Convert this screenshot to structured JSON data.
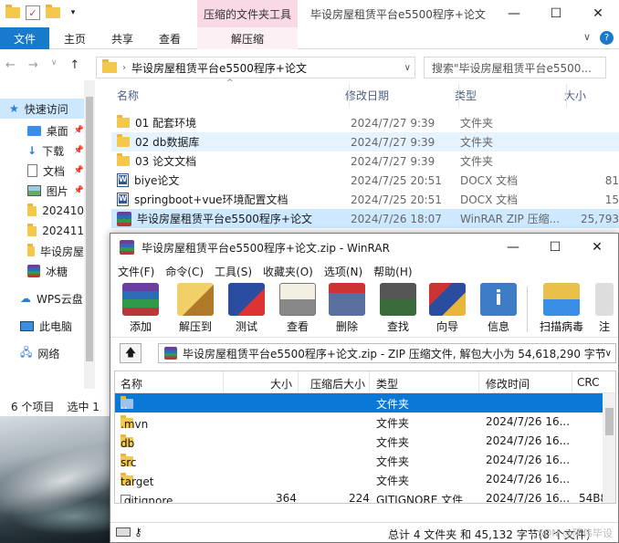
{
  "explorer": {
    "title": "毕设房屋租赁平台e5500程序+论文",
    "context_tab_title": "压缩的文件夹工具",
    "ribbon_tabs": [
      "文件",
      "主页",
      "共享",
      "查看",
      "解压缩"
    ],
    "address_path": "毕设房屋租赁平台e5500程序+论文",
    "search_placeholder": "搜索\"毕设房屋租赁平台e5500...",
    "columns": [
      "名称",
      "修改日期",
      "类型",
      "大小"
    ],
    "files": [
      {
        "name": "01 配套环境",
        "date": "2024/7/27 9:39",
        "type": "文件夹",
        "size": "",
        "icon": "folder-icon"
      },
      {
        "name": "02 db数据库",
        "date": "2024/7/27 9:39",
        "type": "文件夹",
        "size": "",
        "icon": "folder-icon"
      },
      {
        "name": "03 论文文档",
        "date": "2024/7/27 9:39",
        "type": "文件夹",
        "size": "",
        "icon": "folder-icon"
      },
      {
        "name": "biye论文",
        "date": "2024/7/25 20:51",
        "type": "DOCX 文档",
        "size": "81",
        "icon": "word-doc-icon"
      },
      {
        "name": "springboot+vue环境配置文档",
        "date": "2024/7/25 20:51",
        "type": "DOCX 文档",
        "size": "15",
        "icon": "word-doc-icon"
      },
      {
        "name": "毕设房屋租赁平台e5500程序+论文",
        "date": "2024/7/26 18:07",
        "type": "WinRAR ZIP 压缩...",
        "size": "25,793",
        "icon": "winrar-archive-icon"
      }
    ],
    "sidebar": [
      {
        "label": "快速访问",
        "icon": "star-icon"
      },
      {
        "label": "桌面",
        "icon": "desktop-icon",
        "pinned": true
      },
      {
        "label": "下载",
        "icon": "download-icon",
        "pinned": true
      },
      {
        "label": "文档",
        "icon": "document-icon",
        "pinned": true
      },
      {
        "label": "图片",
        "icon": "picture-icon",
        "pinned": true
      },
      {
        "label": "202410",
        "icon": "folder-icon"
      },
      {
        "label": "202411",
        "icon": "folder-icon"
      },
      {
        "label": "毕设房屋",
        "icon": "folder-icon"
      },
      {
        "label": "冰糖",
        "icon": "winrar-archive-icon"
      },
      {
        "label": "WPS云盘",
        "icon": "cloud-icon"
      },
      {
        "label": "此电脑",
        "icon": "computer-icon"
      },
      {
        "label": "网络",
        "icon": "network-icon"
      }
    ],
    "status": {
      "count": "6 个项目",
      "selected": "选中 1"
    }
  },
  "winrar": {
    "title": "毕设房屋租赁平台e5500程序+论文.zip - WinRAR",
    "menu": [
      "文件(F)",
      "命令(C)",
      "工具(S)",
      "收藏夹(O)",
      "选项(N)",
      "帮助(H)"
    ],
    "tools": [
      "添加",
      "解压到",
      "测试",
      "查看",
      "删除",
      "查找",
      "向导",
      "信息",
      "扫描病毒",
      "注"
    ],
    "path": "毕设房屋租赁平台e5500程序+论文.zip - ZIP 压缩文件, 解包大小为 54,618,290 字节",
    "columns": [
      "名称",
      "大小",
      "压缩后大小",
      "类型",
      "修改时间",
      "CRC"
    ],
    "rows": [
      {
        "name": "..",
        "size": "",
        "packed": "",
        "type": "文件夹",
        "modified": "",
        "crc": ""
      },
      {
        "name": ".mvn",
        "size": "",
        "packed": "",
        "type": "文件夹",
        "modified": "2024/7/26 16...",
        "crc": ""
      },
      {
        "name": "db",
        "size": "",
        "packed": "",
        "type": "文件夹",
        "modified": "2024/7/26 16...",
        "crc": ""
      },
      {
        "name": "src",
        "size": "",
        "packed": "",
        "type": "文件夹",
        "modified": "2024/7/26 16...",
        "crc": ""
      },
      {
        "name": "target",
        "size": "",
        "packed": "",
        "type": "文件夹",
        "modified": "2024/7/26 16...",
        "crc": ""
      },
      {
        "name": ".gitignore",
        "size": "364",
        "packed": "224",
        "type": "GITIGNORE 文件",
        "modified": "2024/7/26 16...",
        "crc": "54B8"
      }
    ],
    "status": "总计 4 文件夹 和 45,132 字节(8 个文件)",
    "watermark": "CSDN @阿伟毕设"
  },
  "colors": {
    "accent": "#1979ca",
    "context_tab": "#f9d9e6",
    "selection": "#0a78d7"
  }
}
